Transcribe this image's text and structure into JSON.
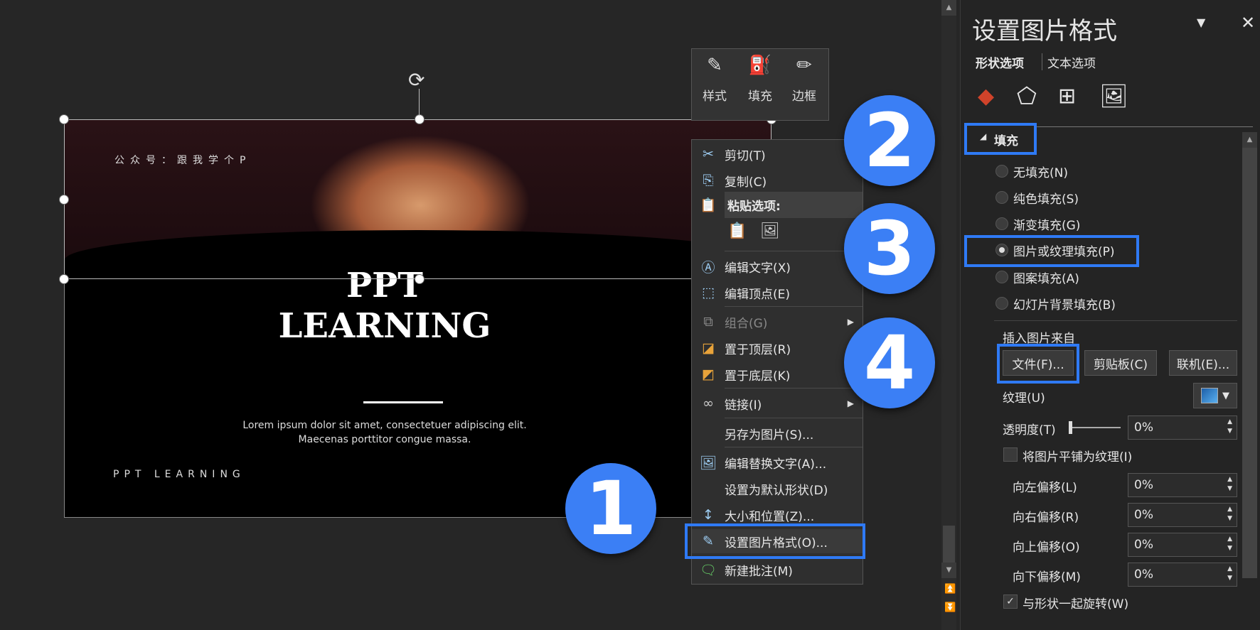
{
  "slide": {
    "wechat": "公众号：跟我学个P",
    "title1": "PPT",
    "title2": "LEARNING",
    "lorem1": "Lorem ipsum dolor sit amet, consectetuer adipiscing elit.",
    "lorem2": "Maecenas porttitor congue massa.",
    "footer": "PPT LEARNING"
  },
  "mini_toolbar": [
    {
      "label": "样式",
      "icon": "style-brush-icon"
    },
    {
      "label": "填充",
      "icon": "fill-bucket-icon"
    },
    {
      "label": "边框",
      "icon": "border-pen-icon"
    }
  ],
  "context_menu": {
    "cut": "剪切(T)",
    "copy": "复制(C)",
    "paste_header": "粘贴选项:",
    "edit_text": "编辑文字(X)",
    "edit_points": "编辑顶点(E)",
    "group": "组合(G)",
    "bring_front": "置于顶层(R)",
    "send_back": "置于底层(K)",
    "link": "链接(I)",
    "save_as_picture": "另存为图片(S)...",
    "edit_alt_text": "编辑替换文字(A)...",
    "set_default_shape": "设置为默认形状(D)",
    "size_position": "大小和位置(Z)...",
    "format_picture": "设置图片格式(O)...",
    "new_comment": "新建批注(M)"
  },
  "steps": [
    "1",
    "2",
    "3",
    "4"
  ],
  "panel": {
    "title": "设置图片格式",
    "tab_shape": "形状选项",
    "tab_text": "文本选项",
    "fill_section": "填充",
    "fill_options": [
      "无填充(N)",
      "纯色填充(S)",
      "渐变填充(G)",
      "图片或纹理填充(P)",
      "图案填充(A)",
      "幻灯片背景填充(B)"
    ],
    "selected_fill": "图片或纹理填充(P)",
    "insert_from": "插入图片来自",
    "btn_file": "文件(F)...",
    "btn_clipboard": "剪贴板(C)",
    "btn_online": "联机(E)...",
    "texture": "纹理(U)",
    "transparency_label": "透明度(T)",
    "transparency": "0%",
    "tile_label": "将图片平铺为纹理(I)",
    "tile_checked": false,
    "offsets": [
      {
        "label": "向左偏移(L)",
        "value": "0%"
      },
      {
        "label": "向右偏移(R)",
        "value": "0%"
      },
      {
        "label": "向上偏移(O)",
        "value": "0%"
      },
      {
        "label": "向下偏移(M)",
        "value": "0%"
      }
    ],
    "rotate_label": "与形状一起旋转(W)",
    "rotate_checked": true
  },
  "colors": {
    "highlight": "#2f7af5",
    "step_circle": "#3b7ff5"
  }
}
